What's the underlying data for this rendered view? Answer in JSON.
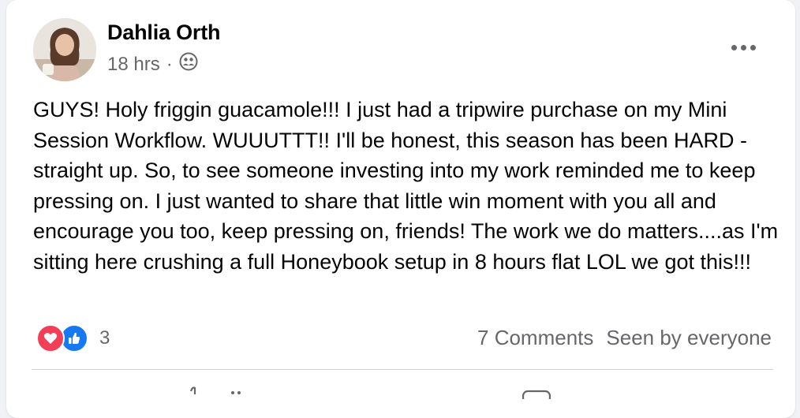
{
  "post": {
    "author": "Dahlia Orth",
    "time": "18 hrs",
    "separator": "·",
    "audience_icon": "friends-audience-icon",
    "more_icon": "more-options-icon",
    "text": "GUYS! Holy friggin guacamole!!! I just had a tripwire purchase on my Mini Session Workflow. WUUUTTT!! I'll be honest, this season has been HARD - straight up. So, to see someone investing into my work reminded me to keep pressing on. I just wanted to share that little win moment with you all and encourage you too, keep pressing on, friends! The work we do matters....as I'm sitting here crushing a full Honeybook setup in 8 hours flat LOL we got this!!!"
  },
  "reactions": {
    "icons": [
      "love-reaction-icon",
      "like-reaction-icon"
    ],
    "count": "3"
  },
  "stats": {
    "comments": "7 Comments",
    "seen": "Seen by everyone"
  },
  "colors": {
    "background": "#f0f2f5",
    "card": "#ffffff",
    "text_primary": "#050505",
    "text_secondary": "#65676b",
    "love": "#f33e58",
    "like": "#1877f2"
  }
}
